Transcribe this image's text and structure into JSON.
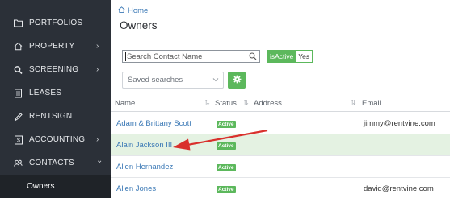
{
  "sidebar": {
    "items": [
      {
        "label": "PORTFOLIOS",
        "icon": "folder-icon",
        "has_chevron": false
      },
      {
        "label": "PROPERTY",
        "icon": "home-icon",
        "has_chevron": true
      },
      {
        "label": "SCREENING",
        "icon": "search-icon",
        "has_chevron": true
      },
      {
        "label": "LEASES",
        "icon": "document-icon",
        "has_chevron": false
      },
      {
        "label": "RENTSIGN",
        "icon": "pen-icon",
        "has_chevron": false
      },
      {
        "label": "ACCOUNTING",
        "icon": "ledger-icon",
        "has_chevron": true
      },
      {
        "label": "CONTACTS",
        "icon": "contacts-icon",
        "has_chevron": true
      }
    ],
    "sub_active": "Owners",
    "chevron_right": "›",
    "chevron_down": "⌄"
  },
  "breadcrumb": {
    "home": "Home"
  },
  "page": {
    "title": "Owners"
  },
  "filters": {
    "search_placeholder": "Search Contact Name",
    "is_active_label": "isActive",
    "is_active_value": "Yes",
    "saved_searches_placeholder": "Saved searches"
  },
  "table": {
    "columns": {
      "name": "Name",
      "status": "Status",
      "address": "Address",
      "email": "Email"
    },
    "rows": [
      {
        "name": "Adam & Brittany Scott",
        "status": "Active",
        "address": "",
        "email": "jimmy@rentvine.com",
        "highlighted": false
      },
      {
        "name": "Alain Jackson III",
        "status": "Active",
        "address": "",
        "email": "",
        "highlighted": true
      },
      {
        "name": "Allen Hernandez",
        "status": "Active",
        "address": "",
        "email": "",
        "highlighted": false
      },
      {
        "name": "Allen Jones",
        "status": "Active",
        "address": "",
        "email": "david@rentvine.com",
        "highlighted": false
      }
    ]
  },
  "colors": {
    "accent_green": "#5cb85c",
    "link_blue": "#3a78b5",
    "sidebar_bg": "#2b3038",
    "highlight_row": "#e4f2e2",
    "arrow_red": "#d9302c"
  }
}
